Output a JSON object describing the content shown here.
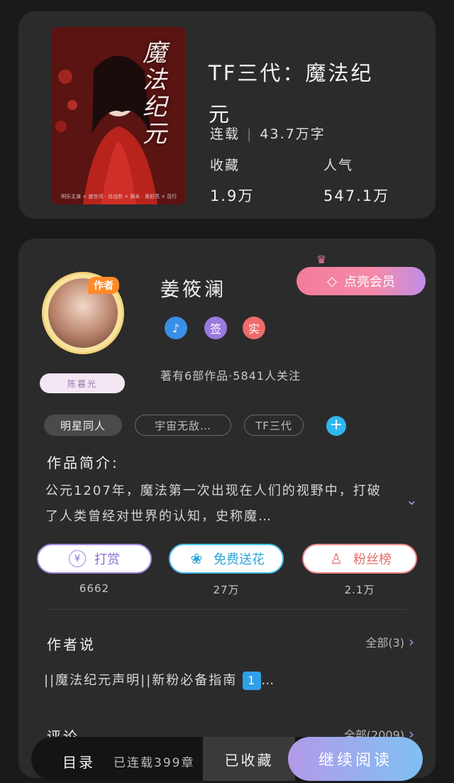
{
  "book": {
    "cover_title": "魔法纪元",
    "cover_credit": "明乐主演 × 盛世鸿 · 肖战剪 × 静未 · 黄舒亮 × 百行",
    "title_line1": "TF三代：魔法纪",
    "title_line2": "元",
    "status": "连载",
    "word_count": "43.7万字",
    "favorites_label": "收藏",
    "favorites_value": "1.9万",
    "popularity_label": "人气",
    "popularity_value": "547.1万"
  },
  "author": {
    "tag": "作者",
    "badge_name": "陈暮光",
    "name": "姜筱澜",
    "vip_button": "点亮会员",
    "badges": [
      {
        "label": "♪",
        "color": "#3a8fe8"
      },
      {
        "label": "签",
        "color": "#9b7ae0"
      },
      {
        "label": "实",
        "color": "#f06b6b"
      }
    ],
    "works_line": "著有6部作品·5841人关注"
  },
  "tags": [
    "明星同人",
    "宇宙无敌…",
    "TF三代"
  ],
  "intro": {
    "title": "作品简介:",
    "text": "公元1207年，魔法第一次出现在人们的视野中，打破了人类曾经对世界的认知，史称魔…"
  },
  "actions": [
    {
      "label": "打赏",
      "icon": "¥",
      "count": "6662",
      "color": "#a489df",
      "text_color": "#8a6fd0"
    },
    {
      "label": "免费送花",
      "icon": "❀",
      "count": "27万",
      "color": "#4cc3ee",
      "text_color": "#2aa6d8"
    },
    {
      "label": "粉丝榜",
      "icon": "♙",
      "count": "2.1万",
      "color": "#f08a8a",
      "text_color": "#e36c6c"
    }
  ],
  "author_says": {
    "title": "作者说",
    "see_all": "全部(3)",
    "post": "||魔法纪元声明||新粉必备指南",
    "post_badge": "1"
  },
  "comments": {
    "title": "评论",
    "see_all": "全部(2009)"
  },
  "bottom_bar": {
    "catalog": "目录",
    "status": "已连载399章",
    "collected": "已收藏",
    "read": "继续阅读"
  }
}
